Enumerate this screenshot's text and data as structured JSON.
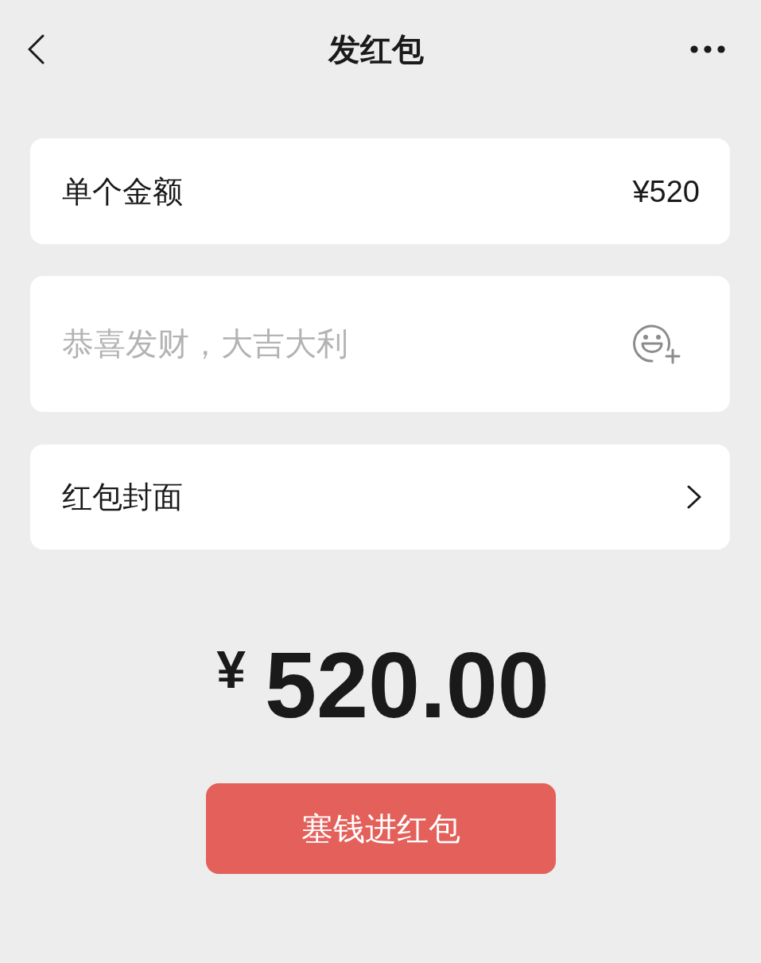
{
  "header": {
    "title": "发红包"
  },
  "amount_row": {
    "label": "单个金额",
    "value": "¥520"
  },
  "greeting": {
    "placeholder": "恭喜发财，大吉大利"
  },
  "cover_row": {
    "label": "红包封面"
  },
  "total": {
    "currency": "¥",
    "amount": "520.00"
  },
  "submit_button": {
    "label": "塞钱进红包"
  }
}
